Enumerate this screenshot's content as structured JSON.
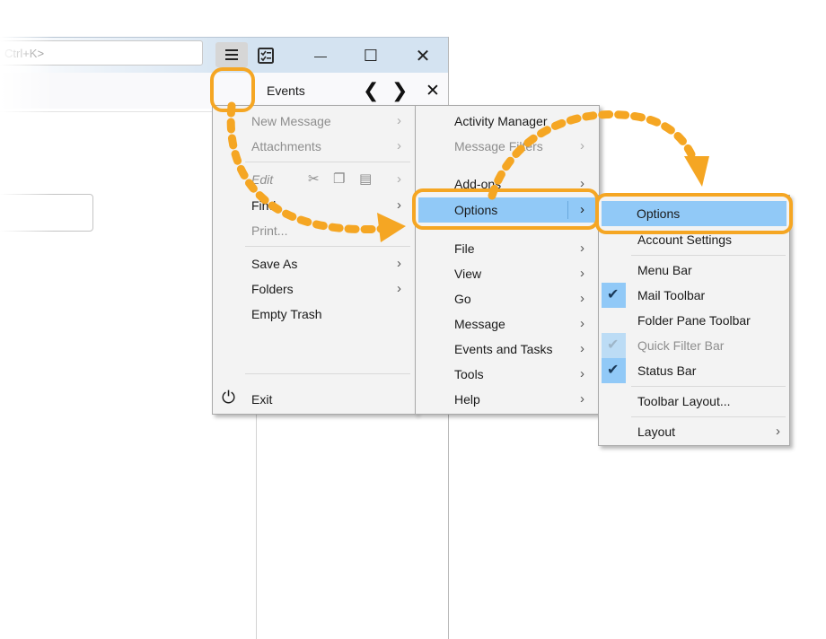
{
  "titlebar": {
    "calendar_icon": "calendar-icon",
    "tasks_icon": "tasks-icon",
    "minimize_glyph": "—",
    "maximize_glyph": "☐",
    "close_glyph": "✕"
  },
  "toolbar": {
    "search_placeholder": "Ctrl+K>",
    "menu_button_icon": "hamburger-menu-icon",
    "events_label": "Events",
    "prev_glyph": "❮",
    "next_glyph": "❯",
    "close_events_glyph": "✕"
  },
  "main_menu": {
    "new_message": "New Message",
    "attachments": "Attachments",
    "edit": "Edit",
    "find": "Find",
    "print": "Print...",
    "save_as": "Save As",
    "folders": "Folders",
    "empty_trash": "Empty Trash",
    "exit": "Exit",
    "arrow": "›",
    "cut_glyph": "✂",
    "copy_glyph": "❐",
    "paste_glyph": "▤",
    "power_glyph": "⏻"
  },
  "sub_menu": {
    "activity_manager": "Activity Manager",
    "message_filters": "Message Filters",
    "add_ons": "Add-ons",
    "options": "Options",
    "file": "File",
    "view": "View",
    "go": "Go",
    "message": "Message",
    "events_and_tasks": "Events and Tasks",
    "tools": "Tools",
    "help": "Help",
    "arrow": "›"
  },
  "options_menu": {
    "options": "Options",
    "account_settings": "Account Settings",
    "menu_bar": "Menu Bar",
    "mail_toolbar": "Mail Toolbar",
    "folder_pane_toolbar": "Folder Pane Toolbar",
    "quick_filter_bar": "Quick Filter Bar",
    "status_bar": "Status Bar",
    "toolbar_layout": "Toolbar Layout...",
    "layout": "Layout",
    "check_glyph": "✔",
    "arrow": "›",
    "mail_toolbar_checked": true,
    "quick_filter_bar_checked": true,
    "status_bar_checked": true
  },
  "colors": {
    "highlight": "#91c9f7",
    "callout": "#f5a623",
    "menu_bg": "#f3f3f3"
  }
}
